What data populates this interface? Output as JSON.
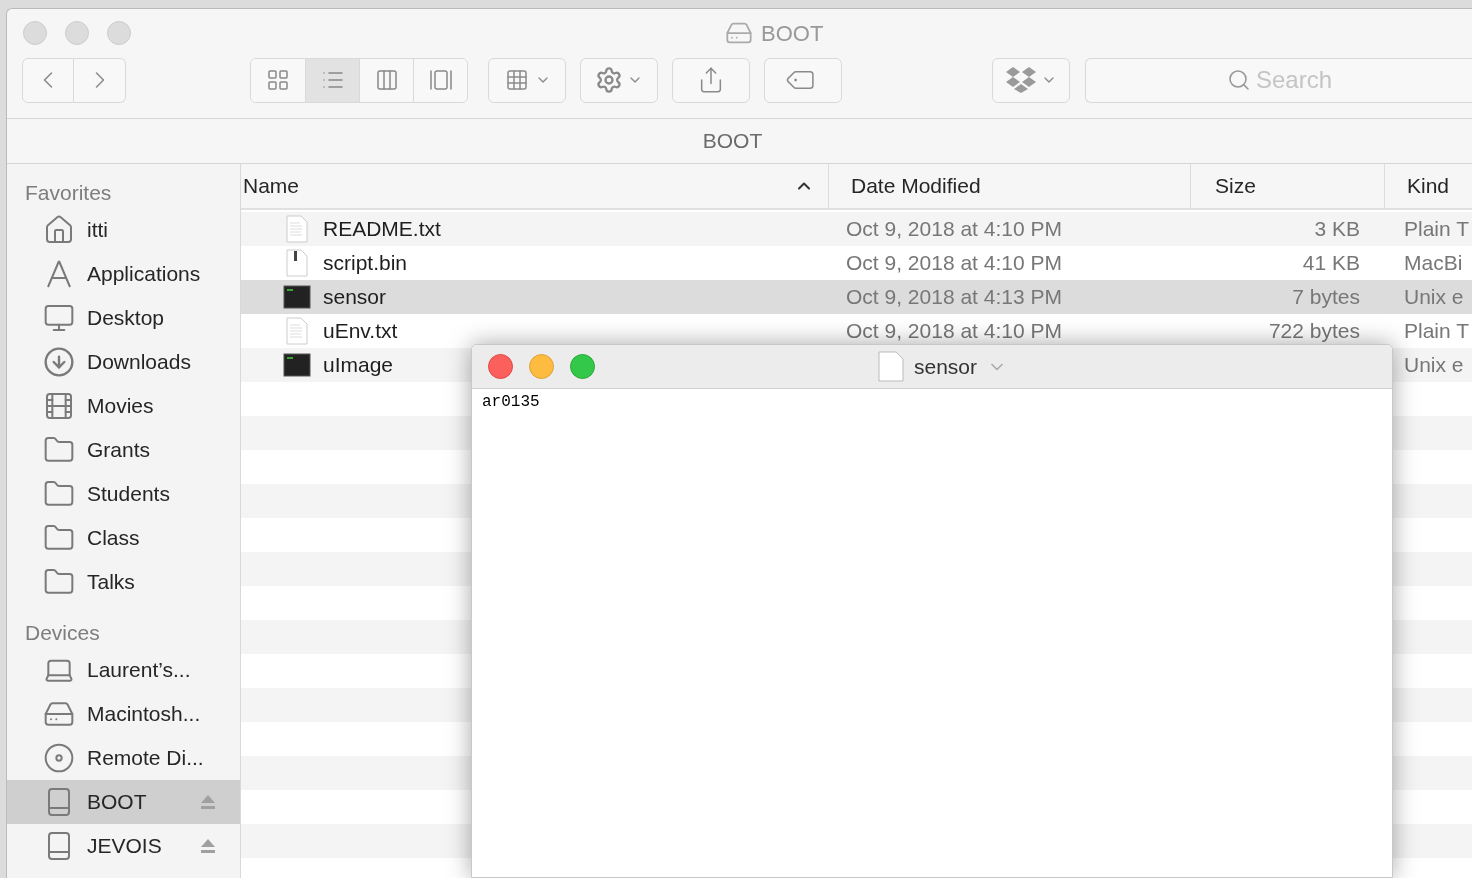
{
  "window": {
    "title": "BOOT"
  },
  "toolbar": {
    "view_modes": [
      {
        "kind": "icons",
        "selected": false
      },
      {
        "kind": "list",
        "selected": true
      },
      {
        "kind": "columns",
        "selected": false
      },
      {
        "kind": "coverflow",
        "selected": false
      }
    ],
    "search": {
      "placeholder": "Search"
    }
  },
  "path_bar": {
    "title": "BOOT"
  },
  "sidebar": {
    "sections": [
      {
        "title": "Favorites",
        "items": [
          {
            "label": "itti",
            "kind": "home",
            "selected": false,
            "ejectable": false
          },
          {
            "label": "Applications",
            "kind": "apps",
            "selected": false,
            "ejectable": false
          },
          {
            "label": "Desktop",
            "kind": "desktop",
            "selected": false,
            "ejectable": false
          },
          {
            "label": "Downloads",
            "kind": "downloads",
            "selected": false,
            "ejectable": false
          },
          {
            "label": "Movies",
            "kind": "movies",
            "selected": false,
            "ejectable": false
          },
          {
            "label": "Grants",
            "kind": "folder",
            "selected": false,
            "ejectable": false
          },
          {
            "label": "Students",
            "kind": "folder",
            "selected": false,
            "ejectable": false
          },
          {
            "label": "Class",
            "kind": "folder",
            "selected": false,
            "ejectable": false
          },
          {
            "label": "Talks",
            "kind": "folder",
            "selected": false,
            "ejectable": false
          }
        ]
      },
      {
        "title": "Devices",
        "items": [
          {
            "label": "Laurent’s...",
            "kind": "laptop",
            "selected": false,
            "ejectable": false
          },
          {
            "label": "Macintosh...",
            "kind": "hdd",
            "selected": false,
            "ejectable": false
          },
          {
            "label": "Remote Di...",
            "kind": "disc",
            "selected": false,
            "ejectable": false
          },
          {
            "label": "BOOT",
            "kind": "drive",
            "selected": true,
            "ejectable": true
          },
          {
            "label": "JEVOIS",
            "kind": "drive",
            "selected": false,
            "ejectable": true
          }
        ]
      }
    ]
  },
  "table": {
    "columns": [
      {
        "label": "Name",
        "sorted": true
      },
      {
        "label": "Date Modified",
        "sorted": false
      },
      {
        "label": "Size",
        "sorted": false
      },
      {
        "label": "Kind",
        "sorted": false
      }
    ],
    "rows": [
      {
        "name": "README.txt",
        "kind": "text",
        "date": "Oct 9, 2018 at 4:10 PM",
        "size": "3 KB",
        "kind_column": "Plain T",
        "selected": false
      },
      {
        "name": "script.bin",
        "kind": "binary",
        "date": "Oct 9, 2018 at 4:10 PM",
        "size": "41 KB",
        "kind_column": "MacBi",
        "selected": false
      },
      {
        "name": "sensor",
        "kind": "exec",
        "date": "Oct 9, 2018 at 4:13 PM",
        "size": "7 bytes",
        "kind_column": "Unix e",
        "selected": true
      },
      {
        "name": "uEnv.txt",
        "kind": "text",
        "date": "Oct 9, 2018 at 4:10 PM",
        "size": "722 bytes",
        "kind_column": "Plain T",
        "selected": false
      },
      {
        "name": "uImage",
        "kind": "exec",
        "kind_column": "Unix e",
        "selected": false
      }
    ]
  },
  "editor": {
    "title": "sensor",
    "content": "ar0135"
  }
}
